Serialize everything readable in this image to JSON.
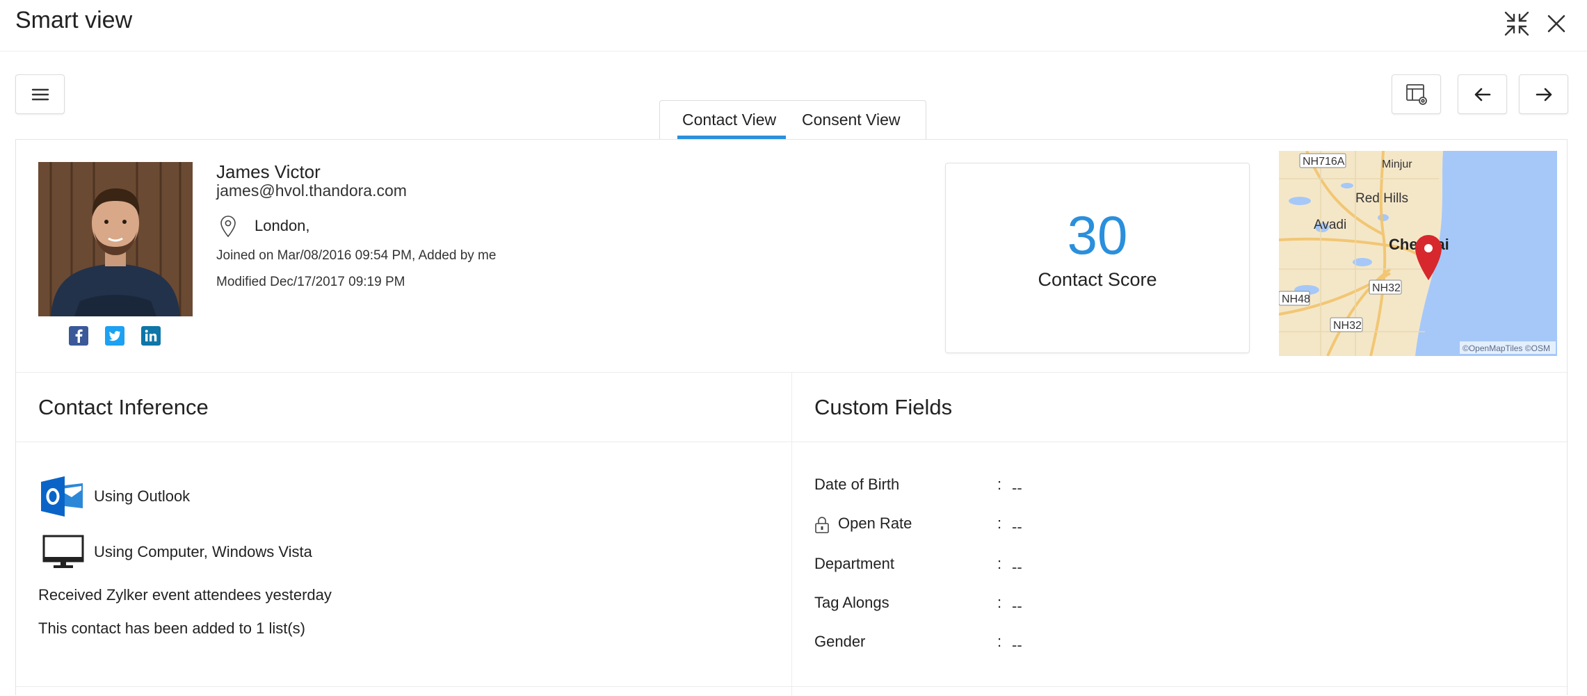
{
  "header": {
    "title": "Smart view"
  },
  "icons": {
    "menu": "hamburger-menu-icon",
    "settings": "table-settings-icon",
    "prev": "arrow-left-icon",
    "next": "arrow-right-icon",
    "collapse": "collapse-icon",
    "close": "close-icon"
  },
  "tabs": [
    {
      "label": "Contact View",
      "active": true
    },
    {
      "label": "Consent View",
      "active": false
    }
  ],
  "contact": {
    "name": "James Victor",
    "email": "james@hvol.thandora.com",
    "location": "London,",
    "joined": "Joined on Mar/08/2016 09:54 PM, Added by me",
    "modified": "Modified Dec/17/2017 09:19 PM",
    "social": [
      "facebook-icon",
      "twitter-icon",
      "linkedin-icon"
    ]
  },
  "score": {
    "value": "30",
    "label": "Contact Score"
  },
  "map": {
    "labels": [
      "NH716A",
      "Minjur",
      "Red Hills",
      "Avadi",
      "Chennai",
      "NH48",
      "NH32",
      "NH32"
    ],
    "attribution": "©OpenMapTiles ©OSM"
  },
  "inference": {
    "title": "Contact Inference",
    "items": [
      {
        "icon": "outlook-icon",
        "text": "Using Outlook"
      },
      {
        "icon": "computer-icon",
        "text": "Using Computer, Windows Vista"
      }
    ],
    "notes": [
      "Received Zylker event attendees yesterday",
      "This contact has been added to 1 list(s)"
    ]
  },
  "custom_fields": {
    "title": "Custom Fields",
    "fields": [
      {
        "label": "Date of Birth",
        "value": "--",
        "locked": false
      },
      {
        "label": "Open Rate",
        "value": "--",
        "locked": true
      },
      {
        "label": "Department",
        "value": "--",
        "locked": false
      },
      {
        "label": "Tag Alongs",
        "value": "--",
        "locked": false
      },
      {
        "label": "Gender",
        "value": "--",
        "locked": false
      }
    ]
  },
  "colors": {
    "accent": "#2a8fdc",
    "facebook": "#3b5998",
    "twitter": "#1da1f2",
    "linkedin": "#0e76a8",
    "outlook": "#0a64c8",
    "map_water": "#a6c8f8",
    "map_pin": "#d6282d"
  }
}
